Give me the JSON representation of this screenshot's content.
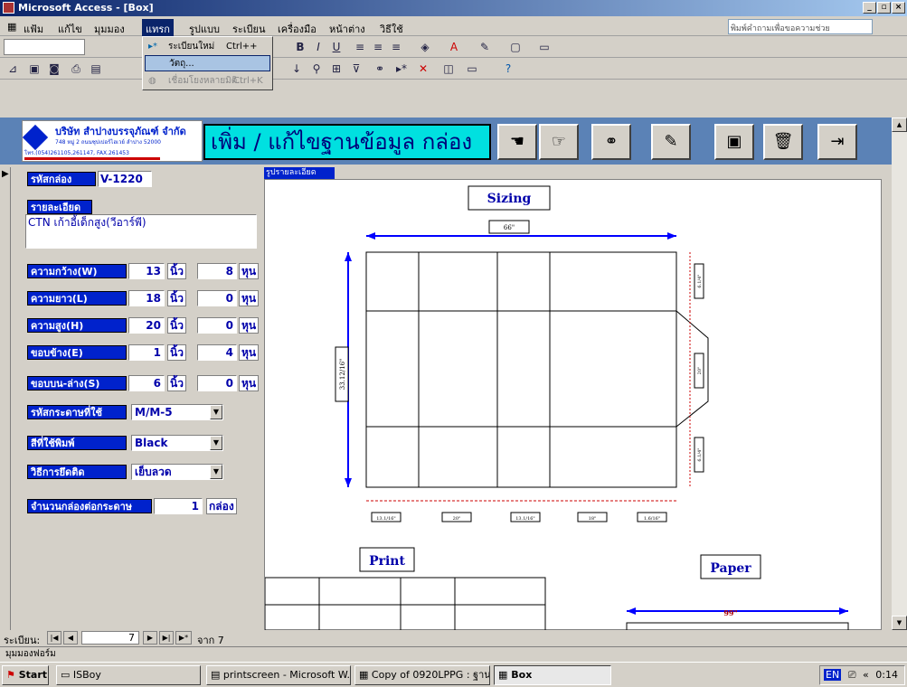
{
  "window": {
    "title": "Microsoft Access - [Box]"
  },
  "menu": {
    "items": [
      "แฟ้ม",
      "แก้ไข",
      "มุมมอง",
      "แทรก",
      "รูปแบบ",
      "ระเบียน",
      "เครื่องมือ",
      "หน้าต่าง",
      "วิธีใช้"
    ],
    "help_placeholder": "พิมพ์คำถามเพื่อขอความช่วย"
  },
  "dropdown": {
    "items": [
      {
        "label": "ระเบียนใหม่",
        "shortcut": "Ctrl++"
      },
      {
        "label": "วัตถุ...",
        "shortcut": ""
      },
      {
        "label": "เชื่อมโยงหลายมิติ...",
        "shortcut": "Ctrl+K"
      }
    ]
  },
  "header": {
    "company": "บริษัท สำปางบรรจุภัณฑ์ จำกัด",
    "address": "748 หมู่ 2 ถนนซุปเปอร์ไฮเวย์ ลำปาง 52000",
    "phone": "โทร.(054)261105,261147, FAX.261453",
    "title": "เพิ่ม / แก้ไขฐานข้อมูล กล่อง"
  },
  "form": {
    "box_code_label": "รหัสกล่อง",
    "box_code": "V-1220",
    "detail_label": "รายละเอียด",
    "detail": "CTN เก้าอี้เด็กสูง(วีอาร์พี)",
    "width_label": "ความกว้าง(W)",
    "width_in": "13",
    "width_hun": "8",
    "length_label": "ความยาว(L)",
    "length_in": "18",
    "length_hun": "0",
    "height_label": "ความสูง(H)",
    "height_in": "20",
    "height_hun": "0",
    "edge_label": "ขอบข้าง(E)",
    "edge_in": "1",
    "edge_hun": "4",
    "topbottom_label": "ขอบบน-ล่าง(S)",
    "topbottom_in": "6",
    "topbottom_hun": "0",
    "unit_inch": "นิ้ว",
    "unit_hun": "หุน",
    "paper_code_label": "รหัสกระดาษที่ใช้",
    "paper_code": "M/M-5",
    "color_label": "สีที่ใช้พิมพ์",
    "color": "Black",
    "join_label": "วิธีการยึดติด",
    "join": "เย็บลวด",
    "perboard_label": "จำนวนกล่องต่อกระดาษ",
    "perboard": "1",
    "perboard_unit": "กล่อง"
  },
  "drawing": {
    "tab": "รูปรายละเอียดกล่อง",
    "sizing": "Sizing",
    "print": "Print",
    "paper": "Paper",
    "dim_top": "66\"",
    "dim_left": "33.12/16\"",
    "dim_r1": "6.1/4\"",
    "dim_r2": "20\"",
    "dim_r3": "6.1/4\"",
    "dim_b": [
      "13.1/16\"",
      "20\"",
      "13.1/16\"",
      "18\"",
      "1.6/16\""
    ],
    "paper_w": "99\""
  },
  "recnav": {
    "label": "ระเบียน:",
    "current": "7",
    "total": "จาก 7"
  },
  "status": "มุมมองฟอร์ม",
  "taskbar": {
    "start": "Start",
    "tasks": [
      "ISBoy",
      "printscreen - Microsoft W...",
      "Copy of 0920LPPG : ฐาน...",
      "Box"
    ],
    "lang": "EN",
    "time": "0:14"
  }
}
